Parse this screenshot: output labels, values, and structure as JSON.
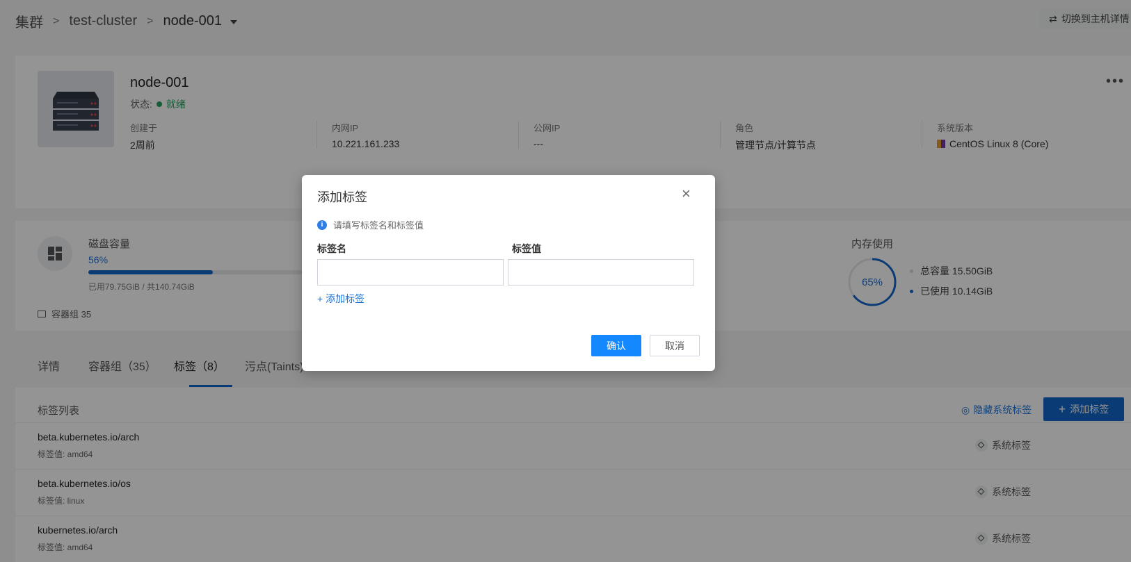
{
  "breadcrumb": {
    "root": "集群",
    "cluster": "test-cluster",
    "node": "node-001"
  },
  "header": {
    "switch_label": "切换到主机详情"
  },
  "node": {
    "name": "node-001",
    "status_label": "状态:",
    "status_value": "就绪",
    "info": [
      {
        "label": "创建于",
        "value": "2周前"
      },
      {
        "label": "内网IP",
        "value": "10.221.161.233"
      },
      {
        "label": "公网IP",
        "value": "---"
      },
      {
        "label": "角色",
        "value": "管理节点/计算节点"
      },
      {
        "label": "系统版本",
        "value": "CentOS Linux 8 (Core)"
      }
    ]
  },
  "disk": {
    "title": "磁盘容量",
    "percent": "56%",
    "fill_fraction": 0.56,
    "detail": "已用79.75GiB / 共140.74GiB"
  },
  "pods": {
    "label": "容器组 35"
  },
  "memory": {
    "title": "内存使用",
    "percent": "65%",
    "fill_fraction": 0.65,
    "total": "总容量 15.50GiB",
    "used": "已使用 10.14GiB"
  },
  "tabs": [
    {
      "label": "详情"
    },
    {
      "label": "容器组（35）"
    },
    {
      "label": "标签（8）"
    },
    {
      "label": "污点(Taints)"
    }
  ],
  "list": {
    "title": "标签列表",
    "hide_label": "隐藏系统标签",
    "add_label": "添加标签",
    "rows": [
      {
        "key": "beta.kubernetes.io/arch",
        "value": "标签值: amd64",
        "badge": "系统标签"
      },
      {
        "key": "beta.kubernetes.io/os",
        "value": "标签值: linux",
        "badge": "系统标签"
      },
      {
        "key": "kubernetes.io/arch",
        "value": "标签值: amd64",
        "badge": "系统标签"
      }
    ]
  },
  "modal": {
    "title": "添加标签",
    "close_icon": "×",
    "notice": "请填写标签名和标签值",
    "name_label": "标签名",
    "value_label": "标签值",
    "name_value": "",
    "value_value": "",
    "add_link": "+ 添加标签",
    "ok": "确认",
    "cancel": "取消"
  },
  "colors": {
    "primary": "#1489ff",
    "accent": "#1467c8",
    "success": "#22a35b"
  }
}
